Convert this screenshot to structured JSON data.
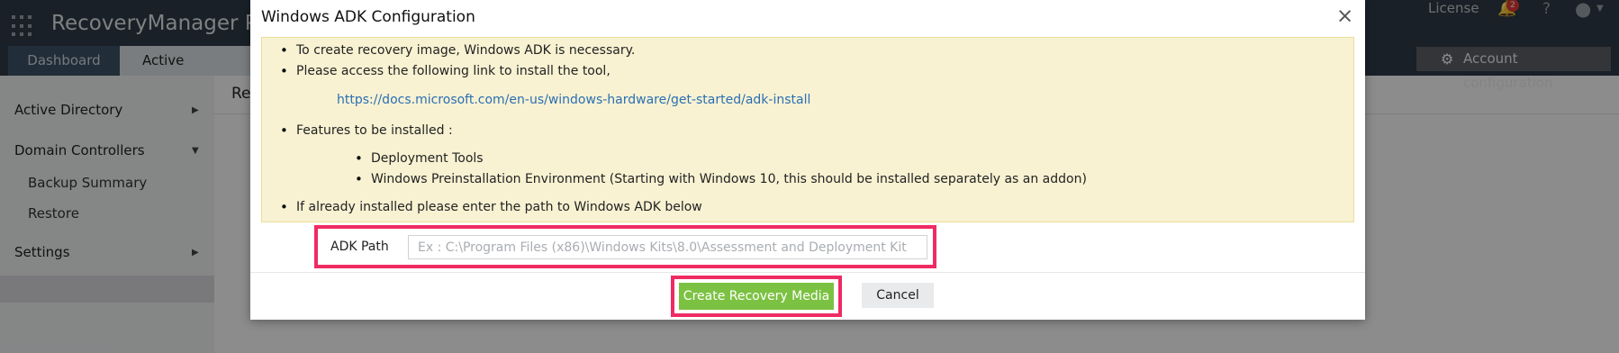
{
  "app": {
    "brand": "RecoveryManager Plus",
    "license_label": "License",
    "notification_count": "2",
    "help_label": "?",
    "icons": [
      "apps-grid-icon",
      "bell-icon",
      "help-icon",
      "user-icon",
      "gear-icon",
      "chevron-right-icon",
      "chevron-down-icon",
      "close-icon"
    ]
  },
  "tabs": [
    {
      "label": "Dashboard"
    },
    {
      "label": "Active Directory"
    }
  ],
  "account_button": {
    "label": "Account configuration"
  },
  "sidebar": {
    "items": [
      {
        "label": "Active Directory"
      },
      {
        "label": "Domain Controllers"
      },
      {
        "label": "Backup Summary"
      },
      {
        "label": "Restore"
      },
      {
        "label": "Settings"
      }
    ]
  },
  "content": {
    "title": "Re"
  },
  "modal": {
    "title": "Windows ADK Configuration",
    "close": "×",
    "info": {
      "line1": "To create recovery image, Windows ADK is necessary.",
      "line2": "Please access the following link to install the tool,",
      "link": "https://docs.microsoft.com/en-us/windows-hardware/get-started/adk-install",
      "line3": "Features to be installed :",
      "features": [
        "Deployment Tools",
        "Windows Preinstallation Environment (Starting with Windows 10, this should be installed separately as an addon)"
      ],
      "line4": "If already installed please enter the path to Windows ADK below"
    },
    "adk_path": {
      "label": "ADK Path",
      "value": "",
      "placeholder": "Ex : C:\\Program Files (x86)\\Windows Kits\\8.0\\Assessment and Deployment Kit"
    },
    "buttons": {
      "create": "Create Recovery Media",
      "cancel": "Cancel"
    }
  },
  "colors": {
    "topbar": "#2e3b47",
    "accent_green": "#7cc242",
    "highlight_pink": "#ef2b63",
    "info_bg": "#f8f2d2",
    "link": "#2a6fb3"
  }
}
